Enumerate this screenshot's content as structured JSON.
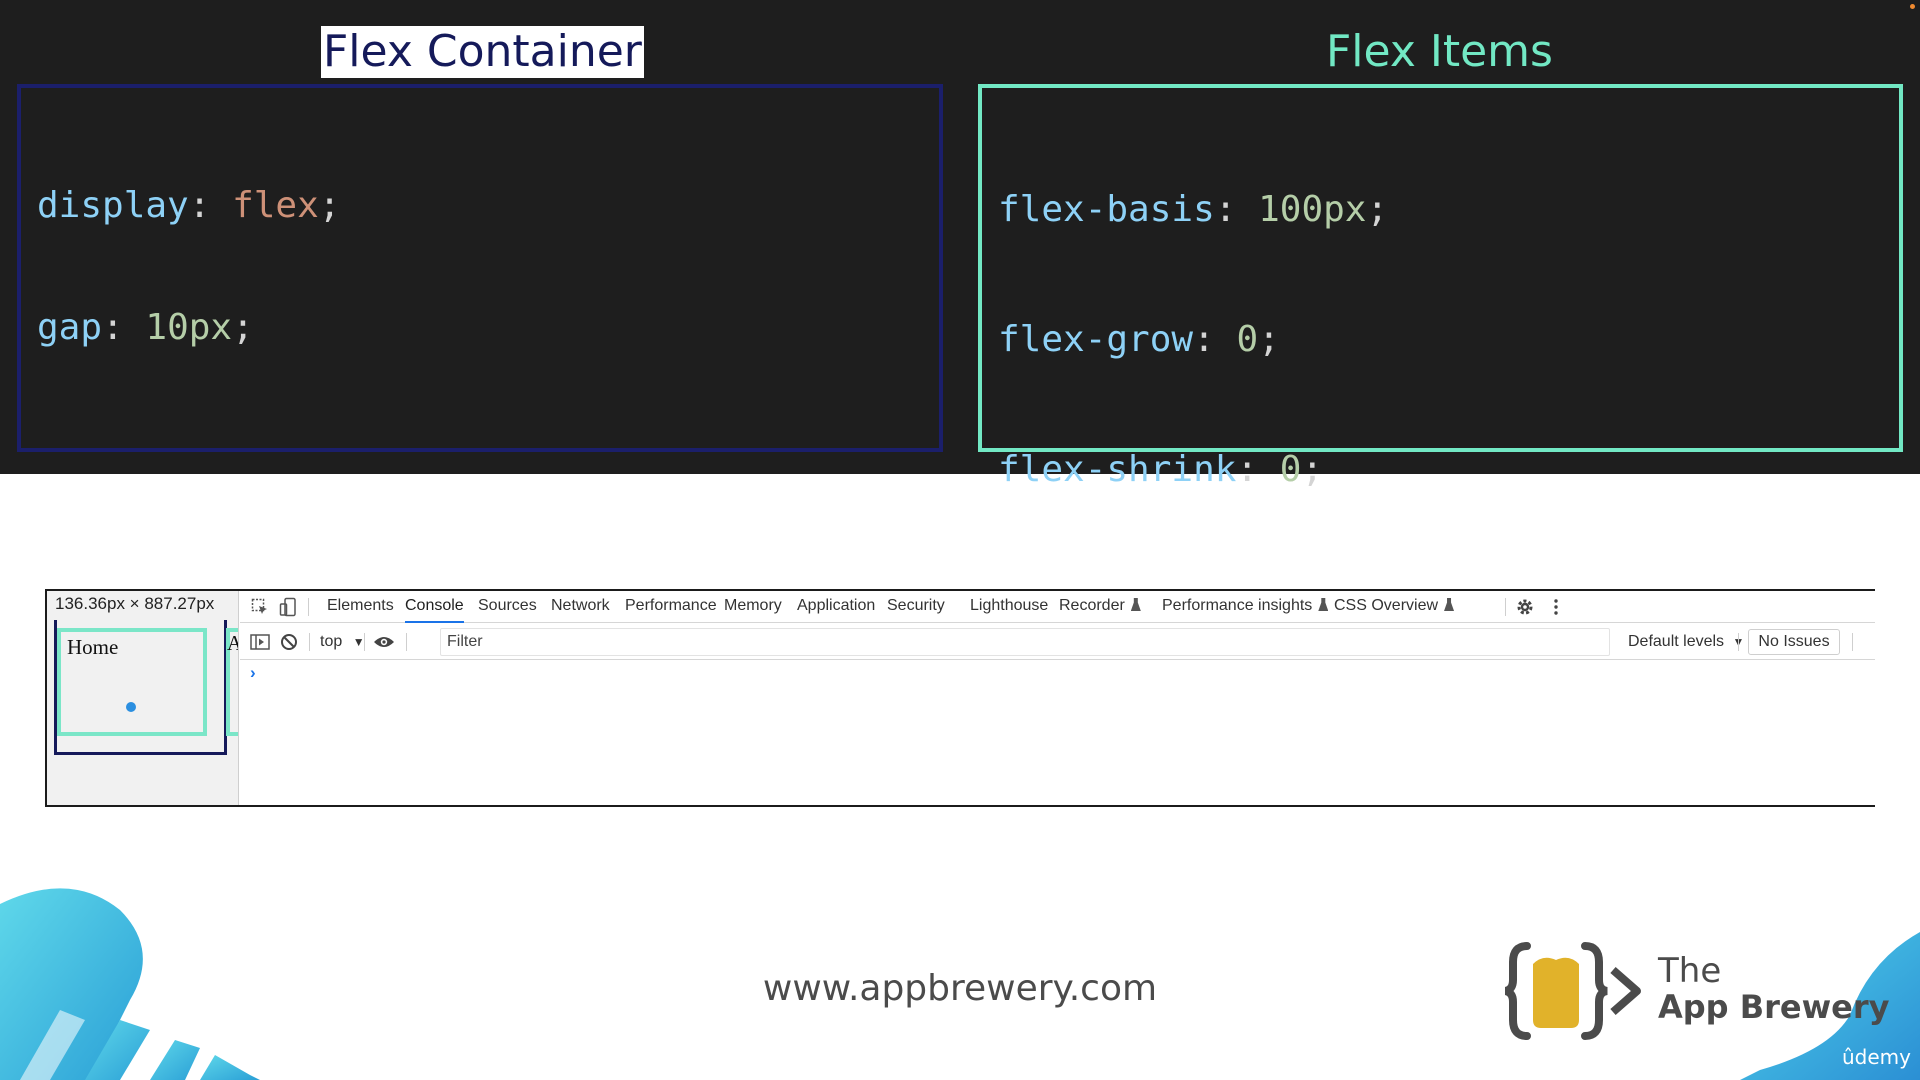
{
  "slide": {
    "container_heading": "Flex Container",
    "items_heading": "Flex Items",
    "container_code": [
      {
        "prop": "display",
        "value": "flex"
      },
      {
        "prop": "gap",
        "value": "10px"
      }
    ],
    "items_code": [
      {
        "prop": "flex-basis",
        "value": "100px"
      },
      {
        "prop": "flex-grow",
        "value": "0"
      },
      {
        "prop": "flex-shrink",
        "value": "0"
      }
    ]
  },
  "devtools": {
    "dimensions": "136.36px × 887.27px",
    "preview_home": "Home",
    "preview_second": "A",
    "tabs": [
      "Elements",
      "Console",
      "Sources",
      "Network",
      "Performance",
      "Memory",
      "Application",
      "Security",
      "Lighthouse",
      "Recorder",
      "Performance insights",
      "CSS Overview"
    ],
    "active_tab": "Console",
    "context": "top",
    "filter_placeholder": "Filter",
    "levels": "Default levels",
    "issues": "No Issues",
    "prompt": "›"
  },
  "footer": {
    "url": "www.appbrewery.com",
    "brand_the": "The",
    "brand_name": "App Brewery",
    "platform": "ûdemy"
  },
  "colors": {
    "slide_bg": "#1e1e1e",
    "container_accent": "#1b1f6b",
    "items_accent": "#72e8c4",
    "active_tab_underline": "#1a73e8",
    "brand_gold": "#e1b22a",
    "decor_cyan": "#3cc7e6"
  },
  "icons": [
    "inspect-element-icon",
    "device-toggle-icon",
    "sidebar-toggle-icon",
    "clear-console-icon",
    "eye-icon",
    "gear-icon",
    "kebab-menu-icon",
    "flask-icon"
  ]
}
